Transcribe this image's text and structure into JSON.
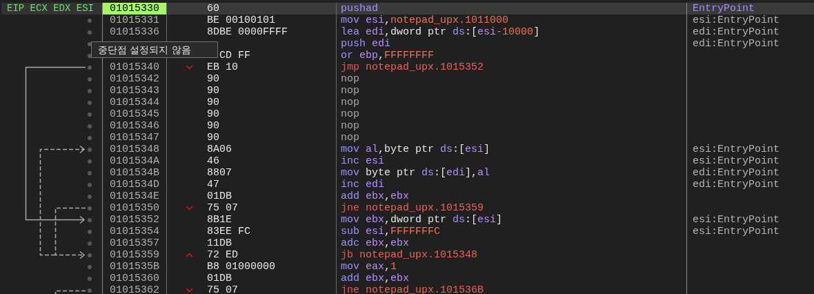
{
  "tooltip": {
    "text": "중단점 설정되지 않음"
  },
  "rows": [
    {
      "registers": "EIP ECX EDX ESI",
      "address": "01015330",
      "bytes": "60",
      "selected": true,
      "instruction": [
        {
          "kind": "op",
          "t": "pushad"
        }
      ],
      "comment": {
        "text": "EntryPoint",
        "kind": "label"
      }
    },
    {
      "address": "01015331",
      "bytes": "BE 00100101",
      "selected": false,
      "instruction": [
        {
          "kind": "op",
          "t": "mov"
        },
        {
          "kind": "reg",
          "t": " esi"
        },
        {
          "kind": "plain",
          "t": ","
        },
        {
          "kind": "num",
          "t": "notepad_upx.1011000"
        }
      ],
      "comment": {
        "text": "esi:EntryPoint",
        "kind": "auto"
      }
    },
    {
      "address": "01015336",
      "bytes": "8DBE 0000FFFF",
      "selected": false,
      "instruction": [
        {
          "kind": "op",
          "t": "lea"
        },
        {
          "kind": "reg",
          "t": " edi"
        },
        {
          "kind": "plain",
          "t": ",dword ptr "
        },
        {
          "kind": "seg",
          "t": "ds"
        },
        {
          "kind": "plain",
          "t": ":["
        },
        {
          "kind": "reg",
          "t": "esi"
        },
        {
          "kind": "num",
          "t": "-10000"
        },
        {
          "kind": "plain",
          "t": "]"
        }
      ],
      "comment": {
        "text": "edi:EntryPoint",
        "kind": "auto"
      }
    },
    {
      "selected": false,
      "instruction": [
        {
          "kind": "op",
          "t": "push"
        },
        {
          "kind": "reg",
          "t": " edi"
        }
      ],
      "comment": {
        "text": "edi:EntryPoint",
        "kind": "auto"
      }
    },
    {
      "bytes": "CD FF",
      "selected": false,
      "instruction": [
        {
          "kind": "op",
          "t": "or"
        },
        {
          "kind": "reg",
          "t": " ebp"
        },
        {
          "kind": "plain",
          "t": ","
        },
        {
          "kind": "num",
          "t": "FFFFFFFF"
        }
      ]
    },
    {
      "address": "01015340",
      "bytes": "EB 10",
      "kind": "jump_down",
      "selected": false,
      "instruction": [
        {
          "kind": "jmp",
          "t": "jmp"
        },
        {
          "kind": "target",
          "t": " notepad_upx.1015352"
        }
      ]
    },
    {
      "address": "01015342",
      "bytes": "90",
      "selected": false,
      "instruction": [
        {
          "kind": "nop",
          "t": "nop"
        }
      ]
    },
    {
      "address": "01015343",
      "bytes": "90",
      "selected": false,
      "instruction": [
        {
          "kind": "nop",
          "t": "nop"
        }
      ]
    },
    {
      "address": "01015344",
      "bytes": "90",
      "selected": false,
      "instruction": [
        {
          "kind": "nop",
          "t": "nop"
        }
      ]
    },
    {
      "address": "01015345",
      "bytes": "90",
      "selected": false,
      "instruction": [
        {
          "kind": "nop",
          "t": "nop"
        }
      ]
    },
    {
      "address": "01015346",
      "bytes": "90",
      "selected": false,
      "instruction": [
        {
          "kind": "nop",
          "t": "nop"
        }
      ]
    },
    {
      "address": "01015347",
      "bytes": "90",
      "selected": false,
      "instruction": [
        {
          "kind": "nop",
          "t": "nop"
        }
      ]
    },
    {
      "address": "01015348",
      "bytes": "8A06",
      "selected": false,
      "instruction": [
        {
          "kind": "op",
          "t": "mov"
        },
        {
          "kind": "reg",
          "t": " al"
        },
        {
          "kind": "plain",
          "t": ",byte ptr "
        },
        {
          "kind": "seg",
          "t": "ds"
        },
        {
          "kind": "plain",
          "t": ":["
        },
        {
          "kind": "reg",
          "t": "esi"
        },
        {
          "kind": "plain",
          "t": "]"
        }
      ],
      "comment": {
        "text": "esi:EntryPoint",
        "kind": "auto"
      }
    },
    {
      "address": "0101534A",
      "bytes": "46",
      "selected": false,
      "instruction": [
        {
          "kind": "op",
          "t": "inc"
        },
        {
          "kind": "reg",
          "t": " esi"
        }
      ],
      "comment": {
        "text": "esi:EntryPoint",
        "kind": "auto"
      }
    },
    {
      "address": "0101534B",
      "bytes": "8807",
      "selected": false,
      "instruction": [
        {
          "kind": "op",
          "t": "mov"
        },
        {
          "kind": "plain",
          "t": " byte ptr "
        },
        {
          "kind": "seg",
          "t": "ds"
        },
        {
          "kind": "plain",
          "t": ":["
        },
        {
          "kind": "reg",
          "t": "edi"
        },
        {
          "kind": "plain",
          "t": "],"
        },
        {
          "kind": "reg",
          "t": "al"
        }
      ],
      "comment": {
        "text": "edi:EntryPoint",
        "kind": "auto"
      }
    },
    {
      "address": "0101534D",
      "bytes": "47",
      "selected": false,
      "instruction": [
        {
          "kind": "op",
          "t": "inc"
        },
        {
          "kind": "reg",
          "t": " edi"
        }
      ],
      "comment": {
        "text": "edi:EntryPoint",
        "kind": "auto"
      }
    },
    {
      "address": "0101534E",
      "bytes": "01DB",
      "selected": false,
      "instruction": [
        {
          "kind": "op",
          "t": "add"
        },
        {
          "kind": "reg",
          "t": " ebx"
        },
        {
          "kind": "plain",
          "t": ","
        },
        {
          "kind": "reg",
          "t": "ebx"
        }
      ]
    },
    {
      "address": "01015350",
      "bytes": "75 07",
      "kind": "jump_down",
      "selected": false,
      "instruction": [
        {
          "kind": "jmp",
          "t": "jne"
        },
        {
          "kind": "target",
          "t": " notepad_upx.1015359"
        }
      ]
    },
    {
      "address": "01015352",
      "bytes": "8B1E",
      "selected": false,
      "instruction": [
        {
          "kind": "op",
          "t": "mov"
        },
        {
          "kind": "reg",
          "t": " ebx"
        },
        {
          "kind": "plain",
          "t": ",dword ptr "
        },
        {
          "kind": "seg",
          "t": "ds"
        },
        {
          "kind": "plain",
          "t": ":["
        },
        {
          "kind": "reg",
          "t": "esi"
        },
        {
          "kind": "plain",
          "t": "]"
        }
      ],
      "comment": {
        "text": "esi:EntryPoint",
        "kind": "auto"
      }
    },
    {
      "address": "01015354",
      "bytes": "83EE FC",
      "selected": false,
      "instruction": [
        {
          "kind": "op",
          "t": "sub"
        },
        {
          "kind": "reg",
          "t": " esi"
        },
        {
          "kind": "plain",
          "t": ","
        },
        {
          "kind": "num",
          "t": "FFFFFFFC"
        }
      ],
      "comment": {
        "text": "esi:EntryPoint",
        "kind": "auto"
      }
    },
    {
      "address": "01015357",
      "bytes": "11DB",
      "selected": false,
      "instruction": [
        {
          "kind": "op",
          "t": "adc"
        },
        {
          "kind": "reg",
          "t": " ebx"
        },
        {
          "kind": "plain",
          "t": ","
        },
        {
          "kind": "reg",
          "t": "ebx"
        }
      ]
    },
    {
      "address": "01015359",
      "bytes": "72 ED",
      "kind": "jump_up",
      "selected": false,
      "instruction": [
        {
          "kind": "jmp",
          "t": "jb"
        },
        {
          "kind": "target",
          "t": " notepad_upx.1015348"
        }
      ]
    },
    {
      "address": "0101535B",
      "bytes": "B8 01000000",
      "selected": false,
      "instruction": [
        {
          "kind": "op",
          "t": "mov"
        },
        {
          "kind": "reg",
          "t": " eax"
        },
        {
          "kind": "plain",
          "t": ","
        },
        {
          "kind": "num",
          "t": "1"
        }
      ]
    },
    {
      "address": "01015360",
      "bytes": "01DB",
      "selected": false,
      "instruction": [
        {
          "kind": "op",
          "t": "add"
        },
        {
          "kind": "reg",
          "t": " ebx"
        },
        {
          "kind": "plain",
          "t": ","
        },
        {
          "kind": "reg",
          "t": "ebx"
        }
      ]
    },
    {
      "address": "01015362",
      "bytes": "75 07",
      "kind": "jump_down",
      "selected": false,
      "instruction": [
        {
          "kind": "jmp",
          "t": "jne"
        },
        {
          "kind": "target",
          "t": " notepad_upx.101536B"
        }
      ]
    }
  ]
}
